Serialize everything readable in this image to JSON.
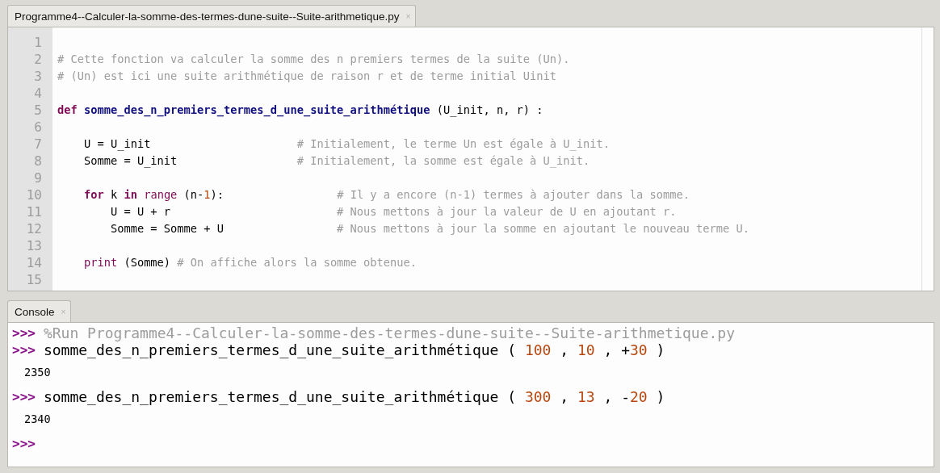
{
  "editor": {
    "tab": {
      "title": "Programme4--Calculer-la-somme-des-termes-dune-suite--Suite-arithmetique.py",
      "close": "×"
    },
    "lines": [
      {
        "number": "1"
      },
      {
        "number": "2",
        "tokens": [
          {
            "kind": "comment",
            "text": "# Cette fonction va calculer la somme des n premiers termes de la suite (Un)."
          }
        ]
      },
      {
        "number": "3",
        "tokens": [
          {
            "kind": "comment",
            "text": "# (Un) est ici une suite arithmétique de raison r et de terme initial Uinit"
          }
        ]
      },
      {
        "number": "4"
      },
      {
        "number": "5",
        "tokens": [
          {
            "kind": "keyword",
            "text": "def "
          },
          {
            "kind": "funcname",
            "text": "somme_des_n_premiers_termes_d_une_suite_arithmétique"
          },
          {
            "kind": "plain",
            "text": " (U_init, n, r) :"
          }
        ]
      },
      {
        "number": "6"
      },
      {
        "number": "7",
        "tokens": [
          {
            "kind": "plain",
            "text": "    U = U_init                      "
          },
          {
            "kind": "comment",
            "text": "# Initialement, le terme Un est égale à U_init."
          }
        ]
      },
      {
        "number": "8",
        "tokens": [
          {
            "kind": "plain",
            "text": "    Somme = U_init                  "
          },
          {
            "kind": "comment",
            "text": "# Initialement, la somme est égale à U_init."
          }
        ]
      },
      {
        "number": "9"
      },
      {
        "number": "10",
        "tokens": [
          {
            "kind": "keyword",
            "text": "    for"
          },
          {
            "kind": "plain",
            "text": " k "
          },
          {
            "kind": "keyword",
            "text": "in "
          },
          {
            "kind": "builtin",
            "text": "range"
          },
          {
            "kind": "plain",
            "text": " (n-"
          },
          {
            "kind": "number",
            "text": "1"
          },
          {
            "kind": "plain",
            "text": "):                 "
          },
          {
            "kind": "comment",
            "text": "# Il y a encore (n-1) termes à ajouter dans la somme."
          }
        ]
      },
      {
        "number": "11",
        "tokens": [
          {
            "kind": "plain",
            "text": "        U = U + r                         "
          },
          {
            "kind": "comment",
            "text": "# Nous mettons à jour la valeur de U en ajoutant r."
          }
        ]
      },
      {
        "number": "12",
        "tokens": [
          {
            "kind": "plain",
            "text": "        Somme = Somme + U                 "
          },
          {
            "kind": "comment",
            "text": "# Nous mettons à jour la somme en ajoutant le nouveau terme U."
          }
        ]
      },
      {
        "number": "13"
      },
      {
        "number": "14",
        "tokens": [
          {
            "kind": "builtin",
            "text": "    print"
          },
          {
            "kind": "plain",
            "text": " (Somme) "
          },
          {
            "kind": "comment",
            "text": "# On affiche alors la somme obtenue."
          }
        ]
      },
      {
        "number": "15"
      }
    ]
  },
  "console": {
    "tab": {
      "title": "Console",
      "close": "×"
    },
    "entries": [
      {
        "kind": "input",
        "prompt": ">>>",
        "tokens": [
          {
            "kind": "comment",
            "text": "%Run Programme4--Calculer-la-somme-des-termes-dune-suite--Suite-arithmetique.py"
          }
        ]
      },
      {
        "kind": "input",
        "prompt": ">>>",
        "tokens": [
          {
            "kind": "plain",
            "text": "somme_des_n_premiers_termes_d_une_suite_arithmétique ( "
          },
          {
            "kind": "number",
            "text": "100"
          },
          {
            "kind": "plain",
            "text": " , "
          },
          {
            "kind": "number",
            "text": "10"
          },
          {
            "kind": "plain",
            "text": " , +"
          },
          {
            "kind": "number",
            "text": "30"
          },
          {
            "kind": "plain",
            "text": " )"
          }
        ]
      },
      {
        "kind": "output",
        "text": "2350"
      },
      {
        "kind": "input",
        "prompt": ">>>",
        "tokens": [
          {
            "kind": "plain",
            "text": "somme_des_n_premiers_termes_d_une_suite_arithmétique ( "
          },
          {
            "kind": "number",
            "text": "300"
          },
          {
            "kind": "plain",
            "text": " , "
          },
          {
            "kind": "number",
            "text": "13"
          },
          {
            "kind": "plain",
            "text": " , -"
          },
          {
            "kind": "number",
            "text": "20"
          },
          {
            "kind": "plain",
            "text": " )"
          }
        ]
      },
      {
        "kind": "output",
        "text": "2340"
      },
      {
        "kind": "input",
        "prompt": ">>>"
      }
    ]
  }
}
